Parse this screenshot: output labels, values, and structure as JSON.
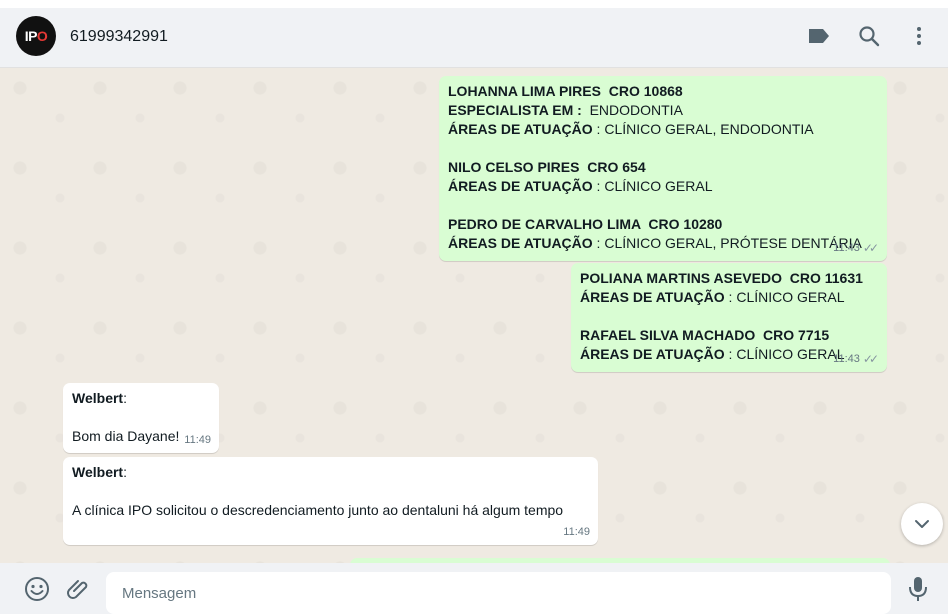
{
  "header": {
    "avatar_text_left": "IP",
    "avatar_text_right": "O",
    "contact_name": "61999342991"
  },
  "messages": [
    {
      "lines": [
        {
          "bold": "LOHANNA LIMA PIRES  CRO 10868",
          "text": ""
        },
        {
          "bold": "ESPECIALISTA EM :",
          "text": "  ENDODONTIA"
        },
        {
          "bold": "ÁREAS DE ATUAÇÃO",
          "text": " : CLÍNICO GERAL, ENDODONTIA"
        },
        {
          "bold": "",
          "text": ""
        },
        {
          "bold": "NILO CELSO PIRES  CRO 654",
          "text": ""
        },
        {
          "bold": "ÁREAS DE ATUAÇÃO",
          "text": " : CLÍNICO GERAL"
        },
        {
          "bold": "",
          "text": ""
        },
        {
          "bold": "PEDRO DE CARVALHO LIMA  CRO 10280",
          "text": ""
        },
        {
          "bold": "ÁREAS DE ATUAÇÃO",
          "text": " : CLÍNICO GERAL, PRÓTESE DENTÁRIA"
        }
      ],
      "time": "11:43"
    },
    {
      "lines": [
        {
          "bold": "POLIANA MARTINS ASEVEDO  CRO 11631",
          "text": ""
        },
        {
          "bold": "ÁREAS DE ATUAÇÃO",
          "text": " : CLÍNICO GERAL"
        },
        {
          "bold": "",
          "text": ""
        },
        {
          "bold": "RAFAEL SILVA MACHADO  CRO 7715",
          "text": ""
        },
        {
          "bold": "ÁREAS DE ATUAÇÃO",
          "text": " : CLÍNICO GERAL"
        }
      ],
      "time": "11:43"
    },
    {
      "sender": "Welbert",
      "sender_suffix": ":",
      "text": "Bom dia Dayane!",
      "time": "11:49"
    },
    {
      "sender": "Welbert",
      "sender_suffix": ":",
      "text": "A clínica IPO solicitou o descredenciamento junto ao dentaluni há algum tempo",
      "time": "11:49"
    }
  ],
  "footer": {
    "placeholder": "Mensagem"
  },
  "icons": {
    "label": "label-icon",
    "search": "search-icon",
    "menu": "menu-icon",
    "emoji": "emoji-icon",
    "attach": "attach-icon",
    "mic": "mic-icon",
    "scroll": "chevron-down-icon"
  }
}
